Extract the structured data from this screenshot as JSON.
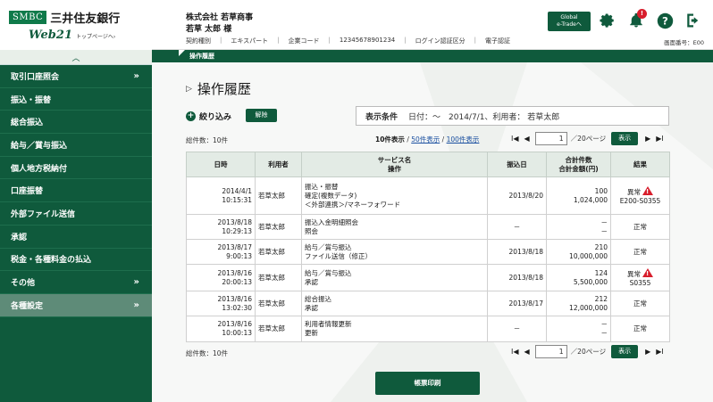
{
  "logo": {
    "smbc": "SMBC",
    "bank": "三井住友銀行",
    "app": "Web21",
    "toppage": "トップページへ›"
  },
  "header": {
    "company": "株式会社 若草商事",
    "user": "若草 太郎 様",
    "meta": [
      "契約種別",
      "エキスパート",
      "企業コード",
      "12345678901234",
      "ログイン認証区分",
      "電子認証"
    ],
    "global_btn": [
      "Global",
      "e-Tradeへ"
    ],
    "notification_count": "!",
    "screen_no": "画面番号：E00"
  },
  "sidebar": {
    "items": [
      {
        "label": "取引口座照会",
        "chevron": "»"
      },
      {
        "label": "振込・振替",
        "chevron": ""
      },
      {
        "label": "総合振込",
        "chevron": ""
      },
      {
        "label": "給与／賞与振込",
        "chevron": ""
      },
      {
        "label": "個人地方税納付",
        "chevron": ""
      },
      {
        "label": "口座振替",
        "chevron": ""
      },
      {
        "label": "外部ファイル送信",
        "chevron": ""
      },
      {
        "label": "承認",
        "chevron": ""
      },
      {
        "label": "税金・各種料金の払込",
        "chevron": ""
      },
      {
        "label": "その他",
        "chevron": "»"
      },
      {
        "label": "各種設定",
        "chevron": "»"
      }
    ]
  },
  "tab": {
    "label": "操作履歴"
  },
  "page": {
    "title": "操作履歴",
    "filter_label": "絞り込み",
    "clear_label": "解除",
    "cond_label": "表示条件",
    "cond_value": "日付：～　2014/7/1、利用者：  若草太郎",
    "total_top": "総件数：10件",
    "total_bottom": "総件数：10件",
    "per_page": {
      "current": "10件表示",
      "sep": " / ",
      "opt50": "50件表示",
      "opt100": "100件表示"
    },
    "pager": {
      "first": "I◀",
      "prev": "◀",
      "value": "1",
      "total": "／20ページ",
      "show": "表示",
      "next": "▶",
      "last": "▶I"
    },
    "print_label": "帳票印刷"
  },
  "table": {
    "headers": {
      "date": "日時",
      "user": "利用者",
      "svc1": "サービス名",
      "svc2": "操作",
      "due": "振込日",
      "amt1": "合計件数",
      "amt2": "合計金額(円)",
      "res": "結果"
    },
    "rows": [
      {
        "date1": "2014/4/1",
        "date2": "10:15:31",
        "user": "若草太郎",
        "svc": [
          "振込・振替",
          "確定(複数データ)",
          "＜外部連携＞/マネーフォワード"
        ],
        "due": "2013/8/20",
        "amt1": "100",
        "amt2": "1,024,000",
        "res1": "異常",
        "res2": "E200-S0355",
        "warn": true
      },
      {
        "date1": "2013/8/18",
        "date2": "10:29:13",
        "user": "若草太郎",
        "svc": [
          "振込入金明細照会",
          "照会"
        ],
        "due": "－",
        "amt1": "－",
        "amt2": "－",
        "res1": "正常",
        "res2": "",
        "warn": false
      },
      {
        "date1": "2013/8/17",
        "date2": "9:00:13",
        "user": "若草太郎",
        "svc": [
          "給与／賞与振込",
          "ファイル送信（修正）"
        ],
        "due": "2013/8/18",
        "amt1": "210",
        "amt2": "10,000,000",
        "res1": "正常",
        "res2": "",
        "warn": false
      },
      {
        "date1": "2013/8/16",
        "date2": "20:00:13",
        "user": "若草太郎",
        "svc": [
          "給与／賞与振込",
          "承認"
        ],
        "due": "2013/8/18",
        "amt1": "124",
        "amt2": "5,500,000",
        "res1": "異常",
        "res2": "S0355",
        "warn": true
      },
      {
        "date1": "2013/8/16",
        "date2": "13:02:30",
        "user": "若草太郎",
        "svc": [
          "総合振込",
          "承認"
        ],
        "due": "2013/8/17",
        "amt1": "212",
        "amt2": "12,000,000",
        "res1": "正常",
        "res2": "",
        "warn": false
      },
      {
        "date1": "2013/8/16",
        "date2": "10:00:13",
        "user": "若草太郎",
        "svc": [
          "利用者情報更新",
          "更新"
        ],
        "due": "－",
        "amt1": "－",
        "amt2": "－",
        "res1": "正常",
        "res2": "",
        "warn": false
      }
    ]
  },
  "colors": {
    "brand": "#0f5a3c",
    "warn": "#d81e2c",
    "link": "#1a4fa0"
  }
}
